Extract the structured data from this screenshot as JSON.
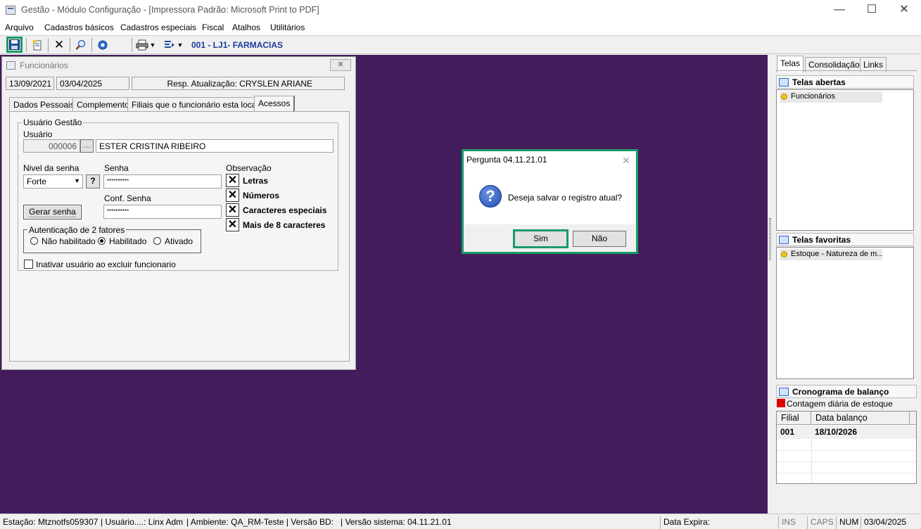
{
  "window": {
    "title": "Gestão  - Módulo Configuração - [Impressora Padrão: Microsoft Print to PDF]",
    "minimize": "—",
    "maximize": "☐",
    "close": "✕"
  },
  "menu": [
    "Arquivo",
    "Cadastros básicos",
    "Cadastros especiais",
    "Fiscal",
    "Atalhos",
    "Utilitários"
  ],
  "toolbar": {
    "store_label": "001 - LJ1- FARMACIAS",
    "icons": [
      "save-icon",
      "new-document-icon",
      "delete-icon",
      "search-icon",
      "refresh-icon",
      "print-icon",
      "export-icon"
    ]
  },
  "funcionarios": {
    "title": "Funcionários",
    "close": "✕",
    "date_created": "13/09/2021",
    "date_updated": "03/04/2025",
    "resp_atualizacao": "Resp. Atualização: CRYSLEN ARIANE",
    "tabs": [
      "Dados Pessoais",
      "Complemento",
      "Filiais que o funcionário esta locado",
      "Acessos"
    ],
    "active_tab": "Acessos",
    "usuario_gestao": {
      "group_label": "Usuário Gestão",
      "usuario_label": "Usuário",
      "usuario_code": "000006",
      "lookup_button": "...",
      "usuario_name": "ESTER CRISTINA RIBEIRO",
      "nivel_label": "Nivel da senha",
      "nivel_value": "Forte",
      "help_button": "?",
      "senha_label": "Senha",
      "senha_value": "**********",
      "conf_senha_label": "Conf. Senha",
      "conf_senha_value": "**********",
      "gerar_senha_button": "Gerar senha",
      "observacao_label": "Observação",
      "observacoes": [
        {
          "label": "Letras",
          "checked": true
        },
        {
          "label": "Números",
          "checked": true
        },
        {
          "label": "Caracteres especiais",
          "checked": true
        },
        {
          "label": "Mais de 8 caracteres",
          "checked": true
        }
      ],
      "auth_label": "Autenticação de 2 fatores",
      "auth_options": [
        "Não habilitado",
        "Habilitado",
        "Ativado"
      ],
      "auth_selected": "Habilitado",
      "inativar_label": "Inativar usuário ao excluir funcionario",
      "inativar_checked": false
    }
  },
  "dialog": {
    "title": "Pergunta 04.11.21.01",
    "close": "✕",
    "message": "Deseja salvar o registro atual?",
    "icon": "question-icon",
    "yes_button": "Sim",
    "no_button": "Não"
  },
  "right_panel": {
    "tabs": [
      "Telas",
      "Consolidação",
      "Links"
    ],
    "active_tab": "Telas",
    "telas_abertas": {
      "title": "Telas abertas",
      "items": [
        "Funcionários"
      ]
    },
    "telas_favoritas": {
      "title": "Telas favoritas",
      "items": [
        "Estoque - Natureza de m..."
      ]
    },
    "cronograma": {
      "title": "Cronograma de balanço",
      "legend": "Contagem diária de estoque",
      "legend_color": "#e00000",
      "columns": [
        "Filial",
        "Data balanço"
      ],
      "rows": [
        [
          "001",
          "18/10/2026"
        ]
      ]
    }
  },
  "statusbar": {
    "estacao": "Estação: Mtznotfs059307",
    "usuario": "| Usuário....: Linx Adm",
    "ambiente": "| Ambiente: QA_RM-Teste | Versão BD:",
    "versao": "| Versão sistema: 04.11.21.01",
    "data_expira": "Data Expira:",
    "ins": "INS",
    "caps": "CAPS",
    "num": "NUM",
    "date": "03/04/2025"
  },
  "colors": {
    "workspace": "#431c5c",
    "highlight": "#179b68",
    "store_label": "#1a3aa0"
  }
}
